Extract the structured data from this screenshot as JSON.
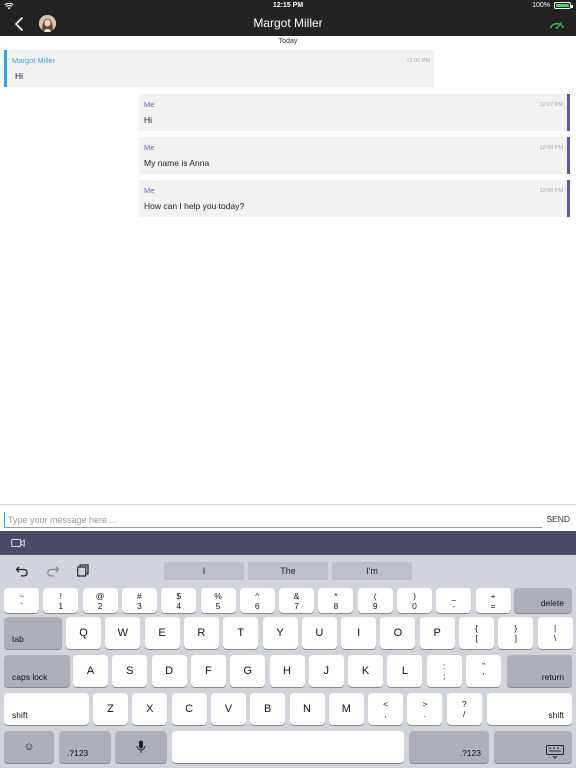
{
  "status_bar": {
    "time": "12:15 PM",
    "battery": "100%",
    "battery_level": 1.0
  },
  "header": {
    "title": "Margot Miller"
  },
  "chat": {
    "date_separator": "Today",
    "messages": [
      {
        "sender": "Margot Miller",
        "time": "12:06 PM",
        "text": "Hi",
        "direction": "incoming"
      },
      {
        "sender": "Me",
        "time": "12:07 PM",
        "text": "Hi",
        "direction": "outgoing"
      },
      {
        "sender": "Me",
        "time": "12:08 PM",
        "text": "My name is Anna",
        "direction": "outgoing"
      },
      {
        "sender": "Me",
        "time": "12:08 PM",
        "text": "How can I help you today?",
        "direction": "outgoing"
      }
    ]
  },
  "composer": {
    "placeholder": "Type your message here ...",
    "value": "",
    "send_label": "SEND"
  },
  "keyboard": {
    "suggestions": [
      "I",
      "The",
      "I'm"
    ],
    "row1": [
      {
        "top": "~",
        "bottom": "`"
      },
      {
        "top": "!",
        "bottom": "1"
      },
      {
        "top": "@",
        "bottom": "2"
      },
      {
        "top": "#",
        "bottom": "3"
      },
      {
        "top": "$",
        "bottom": "4"
      },
      {
        "top": "%",
        "bottom": "5"
      },
      {
        "top": "^",
        "bottom": "6"
      },
      {
        "top": "&",
        "bottom": "7"
      },
      {
        "top": "*",
        "bottom": "8"
      },
      {
        "top": "(",
        "bottom": "9"
      },
      {
        "top": ")",
        "bottom": "0"
      },
      {
        "top": "_",
        "bottom": "-"
      },
      {
        "top": "+",
        "bottom": "="
      }
    ],
    "delete_label": "delete",
    "tab_label": "tab",
    "row2": [
      "Q",
      "W",
      "E",
      "R",
      "T",
      "Y",
      "U",
      "I",
      "O",
      "P"
    ],
    "row2_punct": [
      {
        "top": "{",
        "bottom": "["
      },
      {
        "top": "}",
        "bottom": "]"
      },
      {
        "top": "|",
        "bottom": "\\"
      }
    ],
    "caps_label": "caps lock",
    "row3": [
      "A",
      "S",
      "D",
      "F",
      "G",
      "H",
      "J",
      "K",
      "L"
    ],
    "row3_punct": [
      {
        "top": ":",
        "bottom": ";"
      },
      {
        "top": "”",
        "bottom": "'"
      }
    ],
    "return_label": "return",
    "shift_label": "shift",
    "row4": [
      "Z",
      "X",
      "C",
      "V",
      "B",
      "N",
      "M"
    ],
    "row4_punct": [
      {
        "top": "<",
        "bottom": ","
      },
      {
        "top": ">",
        "bottom": "."
      },
      {
        "top": "?",
        "bottom": "/"
      }
    ],
    "emoji_glyph": "☺",
    "numbers_label": ".?123"
  },
  "colors": {
    "incoming_accent": "#3aa3dd",
    "outgoing_accent": "#5a5aa8",
    "header_bg": "#222222",
    "toolbar_bg": "#4a4a6a"
  }
}
